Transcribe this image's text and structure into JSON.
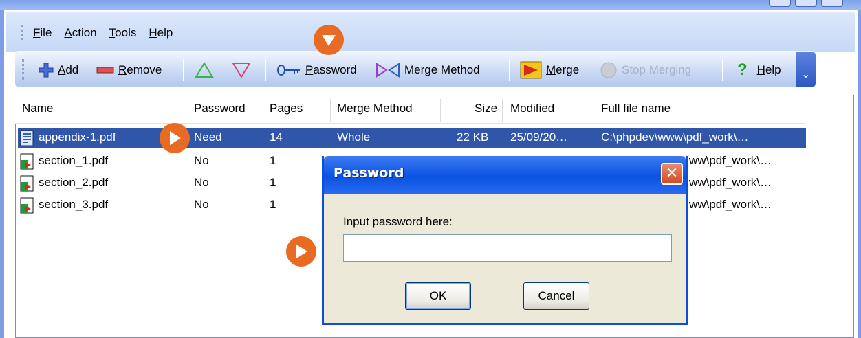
{
  "menu": [
    "File",
    "Action",
    "Tools",
    "Help"
  ],
  "toolbar": {
    "add": "Add",
    "remove": "Remove",
    "password": "Password",
    "merge_method": "Merge Method",
    "merge": "Merge",
    "stop_merging": "Stop Merging",
    "help": "Help"
  },
  "columns": {
    "name": "Name",
    "password": "Password",
    "pages": "Pages",
    "merge_method": "Merge Method",
    "size": "Size",
    "modified": "Modified",
    "full_file_name": "Full file name"
  },
  "rows": [
    {
      "name": "appendix-1.pdf",
      "password": "Need",
      "pages": "14",
      "merge_method": "Whole",
      "size": "22 KB",
      "modified": "25/09/20…",
      "full": "C:\\phpdev\\www\\pdf_work\\…"
    },
    {
      "name": "section_1.pdf",
      "password": "No",
      "pages": "1",
      "full_tail": "ww\\pdf_work\\…"
    },
    {
      "name": "section_2.pdf",
      "password": "No",
      "pages": "1",
      "full_tail": "ww\\pdf_work\\…"
    },
    {
      "name": "section_3.pdf",
      "password": "No",
      "pages": "1",
      "full_tail": "ww\\pdf_work\\…"
    }
  ],
  "dialog": {
    "title": "Password",
    "label": "Input password here:",
    "value": "",
    "ok": "OK",
    "cancel": "Cancel",
    "close": "✕"
  },
  "colors": {
    "selection": "#2f56a8",
    "marker": "#e96a22",
    "dialog_title": "#0a52e0"
  }
}
